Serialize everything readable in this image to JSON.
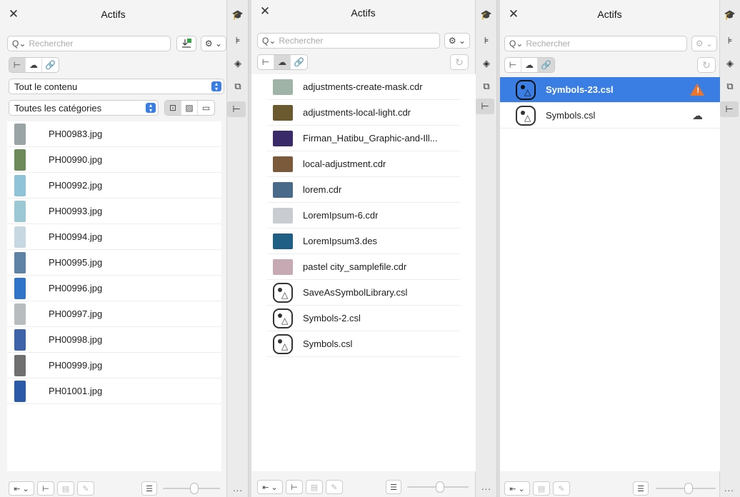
{
  "panel1": {
    "title": "Actifs",
    "search_placeholder": "Rechercher",
    "content_select": "Tout le contenu",
    "category_select": "Toutes les catégories",
    "items": [
      {
        "name": "PH00983.jpg",
        "color": "#9aa3a6"
      },
      {
        "name": "PH00990.jpg",
        "color": "#6f8a5a"
      },
      {
        "name": "PH00992.jpg",
        "color": "#8fc3d8"
      },
      {
        "name": "PH00993.jpg",
        "color": "#9cc8d6"
      },
      {
        "name": "PH00994.jpg",
        "color": "#c7d8e2"
      },
      {
        "name": "PH00995.jpg",
        "color": "#5e83a4"
      },
      {
        "name": "PH00996.jpg",
        "color": "#2f74c8"
      },
      {
        "name": "PH00997.jpg",
        "color": "#b7bcbf"
      },
      {
        "name": "PH00998.jpg",
        "color": "#3f63a8"
      },
      {
        "name": "PH00999.jpg",
        "color": "#6f6f6f"
      },
      {
        "name": "PH01001.jpg",
        "color": "#2c5aa8"
      }
    ]
  },
  "panel2": {
    "title": "Actifs",
    "search_placeholder": "Rechercher",
    "items": [
      {
        "name": "adjustments-create-mask.cdr",
        "kind": "image",
        "color": "#9fb3a7"
      },
      {
        "name": "adjustments-local-light.cdr",
        "kind": "image",
        "color": "#6b5a2f"
      },
      {
        "name": "Firman_Hatibu_Graphic-and-Ill...",
        "kind": "image",
        "color": "#3a2a6a"
      },
      {
        "name": "local-adjustment.cdr",
        "kind": "image",
        "color": "#7a5a3a"
      },
      {
        "name": "lorem.cdr",
        "kind": "image",
        "color": "#4a6a8a"
      },
      {
        "name": "LoremIpsum-6.cdr",
        "kind": "image",
        "color": "#c9ccd0"
      },
      {
        "name": "LoremIpsum3.des",
        "kind": "image",
        "color": "#1f5f86"
      },
      {
        "name": "pastel city_samplefile.cdr",
        "kind": "image",
        "color": "#c7a9b4"
      },
      {
        "name": "SaveAsSymbolLibrary.csl",
        "kind": "symbol"
      },
      {
        "name": "Symbols-2.csl",
        "kind": "symbol"
      },
      {
        "name": "Symbols.csl",
        "kind": "symbol"
      }
    ]
  },
  "panel3": {
    "title": "Actifs",
    "search_placeholder": "Rechercher",
    "items": [
      {
        "name": "Symbols-23.csl",
        "selected": true,
        "status_icon": "warning-icon"
      },
      {
        "name": "Symbols.csl",
        "selected": false,
        "status_icon": "cloud-icon"
      }
    ]
  },
  "colors": {
    "accent": "#3a7ee4",
    "warning": "#e8742e"
  },
  "footer_more": "..."
}
